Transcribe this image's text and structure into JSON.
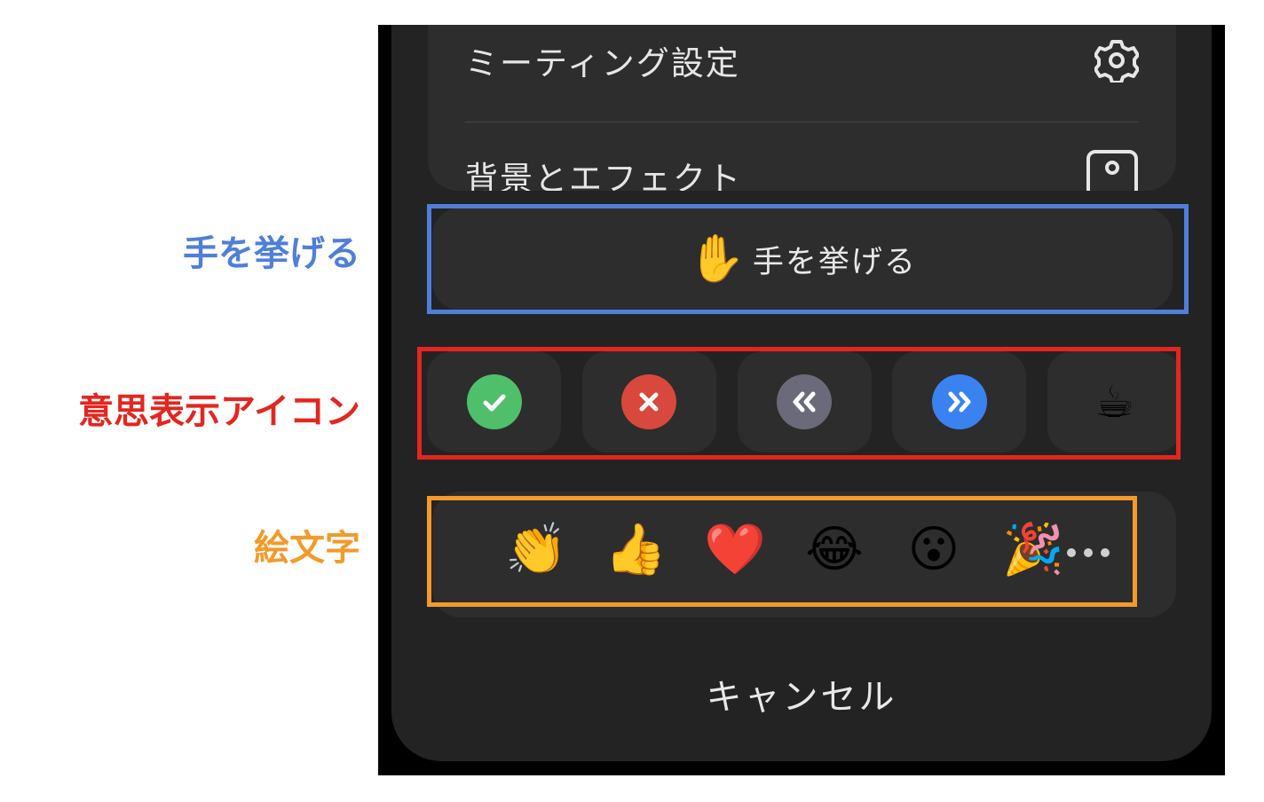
{
  "colors": {
    "blue": "#4f7fd9",
    "red": "#e3261f",
    "orange": "#f39a2b",
    "check_green": "#4fbf6b",
    "cross_red": "#d9483c",
    "slower_gray": "#6b6a7a",
    "faster_blue": "#3b82f1"
  },
  "annotations": {
    "raise_hand": "手を挙げる",
    "status_icons": "意思表示アイコン",
    "emoji": "絵文字"
  },
  "menu": {
    "items": [
      {
        "label": "ミーティング設定",
        "icon": "gear-icon"
      },
      {
        "label": "背景とエフェクト",
        "icon": "background-icon"
      }
    ]
  },
  "raise_hand": {
    "icon": "✋",
    "label": "手を挙げる"
  },
  "status_buttons": [
    {
      "name": "yes",
      "icon": "check-icon"
    },
    {
      "name": "no",
      "icon": "cross-icon"
    },
    {
      "name": "slower",
      "icon": "rewind-icon"
    },
    {
      "name": "faster",
      "icon": "fast-forward-icon"
    },
    {
      "name": "coffee",
      "icon": "☕"
    }
  ],
  "emojis": [
    "👏",
    "👍",
    "❤️",
    "😂",
    "😮",
    "🎉"
  ],
  "more_icon": "more-dots-icon",
  "cancel_label": "キャンセル"
}
